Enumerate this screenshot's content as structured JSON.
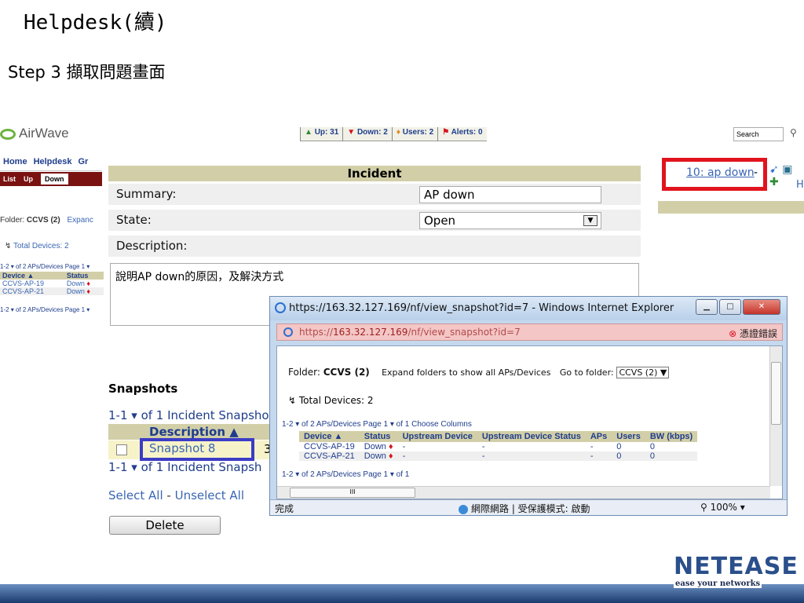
{
  "slide": {
    "title": "Helpdesk(續)",
    "step": "Step 3 擷取問題畫面"
  },
  "airwave": {
    "logo": "AirWave",
    "status": {
      "up": "Up: 31",
      "down": "Down: 2",
      "users": "Users: 2",
      "alerts": "Alerts: 0"
    },
    "search_placeholder": "Search",
    "nav_tabs": [
      "Home",
      "Helpdesk",
      "Gr"
    ],
    "sub_tabs": [
      "List",
      "Up",
      "Down"
    ],
    "folder_label": "Folder:",
    "folder_value": "CCVS (2)",
    "expand": "Expanc",
    "total_devices": "Total Devices: 2",
    "pager": "1-2 ▾ of 2 APs/Devices  Page 1 ▾",
    "pager_bottom": "1-2 ▾ of 2 APs/Devices  Page 1 ▾",
    "left_table": {
      "headers": [
        "Device ▲",
        "Status"
      ],
      "rows": [
        [
          "CCVS-AP-19",
          "Down"
        ],
        [
          "CCVS-AP-21",
          "Down"
        ]
      ]
    }
  },
  "incident": {
    "header": "Incident",
    "summary_label": "Summary:",
    "summary_value": "AP down",
    "state_label": "State:",
    "state_value": "Open",
    "description_label": "Description:",
    "description_value": "說明AP down的原因，及解決方式"
  },
  "snapshots": {
    "title": "Snapshots",
    "pager": "1-1 ▾ of 1 Incident Snapsho",
    "column": "Description ▲",
    "row_label": "Snapshot 8",
    "row_num": "3",
    "pager2": "1-1 ▾ of 1 Incident Snapsh",
    "select_all": "Select All",
    "separator": " - ",
    "unselect_all": "Unselect All",
    "delete": "Delete"
  },
  "right": {
    "incident_link": "10: ap down",
    "dash": "-",
    "h": "H"
  },
  "ie": {
    "title": "https://163.32.127.169/nf/view_snapshot?id=7 - Windows Internet Explorer",
    "addr_prefix": "https://",
    "addr_host": "163.32.127.169",
    "addr_path": "/nf/view_snapshot?id=7",
    "cert_error": "憑證錯誤",
    "folder_label": "Folder:",
    "folder_value": "CCVS (2)",
    "expand_text": "Expand folders to show all APs/Devices",
    "goto_label": "Go to folder:",
    "goto_value": "CCVS (2)",
    "total_devices": "Total Devices: 2",
    "pager_top": "1-2 ▾ of 2 APs/Devices  Page 1 ▾ of 1   Choose Columns",
    "pager_bottom": "1-2 ▾ of 2 APs/Devices  Page 1 ▾ of 1",
    "table": {
      "headers": [
        "Device ▲",
        "Status",
        "Upstream Device",
        "Upstream Device Status",
        "APs",
        "Users",
        "BW (kbps)"
      ],
      "rows": [
        [
          "CCVS-AP-19",
          "Down",
          "-",
          "-",
          "-",
          "0",
          "0"
        ],
        [
          "CCVS-AP-21",
          "Down",
          "-",
          "-",
          "-",
          "0",
          "0"
        ]
      ]
    },
    "status_done": "完成",
    "status_zone": "網際網路 | 受保護模式: 啟動",
    "zoom": "100%"
  },
  "brand": {
    "name": "NETEASE",
    "tagline": "ease your networks"
  },
  "colors": {
    "highlight_red": "#e1141e",
    "highlight_blue": "#3c3cc6",
    "table_header": "#d2cfa8"
  }
}
